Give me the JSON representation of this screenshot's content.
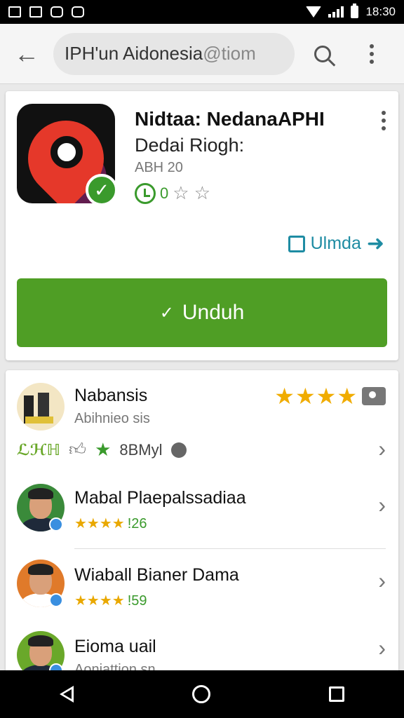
{
  "status_bar": {
    "time": "18:30"
  },
  "app_bar": {
    "search_text": "IPH'un Aidonesia",
    "search_suffix": " @tiom",
    "back_icon": "arrow-left-icon",
    "search_icon": "search-icon",
    "menu_icon": "more-vert-icon"
  },
  "app": {
    "title": "Nidtaa: NedanaAPHI",
    "developer": "Dedai Riogh:",
    "meta": "ABH 20",
    "rating_value": "0",
    "rating_stars": "☆ ☆",
    "more_label": "Ulmda",
    "install_label": "Unduh",
    "accent_green": "#4f9e25",
    "accent_teal": "#1e8ca3"
  },
  "reviews": [
    {
      "name": "Nabansis",
      "subtitle": "Abihnieo sis",
      "stars": "★★★★",
      "action_brand": "yIHi",
      "action_count": "8BMyl"
    },
    {
      "name": "Mabal Plaepalssadiaa",
      "stars": "★★★★",
      "count": "!26"
    },
    {
      "name": "Wiaball Bianer Dama",
      "stars": "★★★★",
      "count": "!59"
    },
    {
      "name": "Eioma uail",
      "subtitle": "Aoniattion sn"
    }
  ]
}
